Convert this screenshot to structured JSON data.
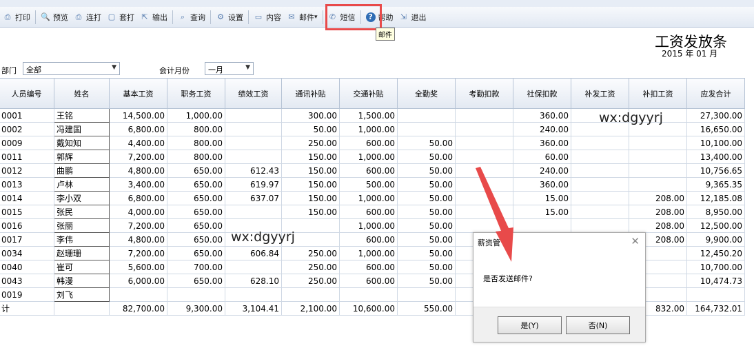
{
  "toolbar": {
    "items": [
      {
        "label": "打印",
        "icon": "printer-icon"
      },
      {
        "label": "预览",
        "icon": "preview-icon"
      },
      {
        "label": "连打",
        "icon": "batch-print-icon"
      },
      {
        "label": "套打",
        "icon": "template-print-icon"
      },
      {
        "label": "输出",
        "icon": "export-icon"
      },
      {
        "label": "查询",
        "icon": "search-icon"
      },
      {
        "label": "设置",
        "icon": "gear-icon"
      },
      {
        "label": "内容",
        "icon": "content-icon"
      },
      {
        "label": "邮件",
        "icon": "mail-icon"
      },
      {
        "label": "短信",
        "icon": "sms-icon"
      },
      {
        "label": "帮助",
        "icon": "help-icon"
      },
      {
        "label": "退出",
        "icon": "exit-icon"
      }
    ],
    "tooltip": "邮件"
  },
  "page": {
    "title": "工资发放条",
    "subtitle": "2015 年 01 月"
  },
  "filters": {
    "dept_label": "部门",
    "dept_value": "全部",
    "month_label": "会计月份",
    "month_value": "一月"
  },
  "table": {
    "headers": [
      "人员编号",
      "姓名",
      "基本工资",
      "职务工资",
      "绩效工资",
      "通讯补贴",
      "交通补贴",
      "全勤奖",
      "考勤扣款",
      "社保扣款",
      "补发工资",
      "补扣工资",
      "应发合计"
    ],
    "rows": [
      [
        "0001",
        "王铭",
        "14,500.00",
        "1,000.00",
        "",
        "300.00",
        "1,500.00",
        "",
        "",
        "360.00",
        "",
        "",
        "27,300.00"
      ],
      [
        "0002",
        "冯建国",
        "6,800.00",
        "800.00",
        "",
        "50.00",
        "1,000.00",
        "",
        "",
        "240.00",
        "",
        "",
        "16,650.00"
      ],
      [
        "0009",
        "戴知知",
        "4,400.00",
        "800.00",
        "",
        "250.00",
        "600.00",
        "50.00",
        "",
        "360.00",
        "",
        "",
        "10,100.00"
      ],
      [
        "0011",
        "郭辉",
        "7,200.00",
        "800.00",
        "",
        "150.00",
        "1,000.00",
        "50.00",
        "",
        "60.00",
        "",
        "",
        "13,400.00"
      ],
      [
        "0012",
        "曲鹏",
        "4,800.00",
        "650.00",
        "612.43",
        "150.00",
        "600.00",
        "50.00",
        "",
        "240.00",
        "",
        "",
        "10,756.65"
      ],
      [
        "0013",
        "卢林",
        "3,400.00",
        "650.00",
        "619.97",
        "150.00",
        "500.00",
        "50.00",
        "",
        "360.00",
        "",
        "",
        "9,365.35"
      ],
      [
        "0014",
        "李小双",
        "6,800.00",
        "650.00",
        "637.07",
        "150.00",
        "1,000.00",
        "50.00",
        "",
        "15.00",
        "",
        "208.00",
        "12,185.08"
      ],
      [
        "0015",
        "张民",
        "4,000.00",
        "650.00",
        "",
        "150.00",
        "600.00",
        "50.00",
        "",
        "15.00",
        "",
        "208.00",
        "8,950.00"
      ],
      [
        "0016",
        "张丽",
        "7,200.00",
        "650.00",
        "",
        "",
        "1,000.00",
        "50.00",
        "",
        "",
        "",
        "208.00",
        "12,500.00"
      ],
      [
        "0017",
        "李伟",
        "4,800.00",
        "650.00",
        "",
        "",
        "600.00",
        "50.00",
        "",
        "",
        "",
        "208.00",
        "9,900.00"
      ],
      [
        "0034",
        "赵珊珊",
        "7,200.00",
        "650.00",
        "606.84",
        "250.00",
        "1,000.00",
        "50.00",
        "",
        "",
        "",
        "",
        "12,450.20"
      ],
      [
        "0040",
        "崔可",
        "5,600.00",
        "700.00",
        "",
        "250.00",
        "600.00",
        "50.00",
        "",
        "",
        "",
        "",
        "10,700.00"
      ],
      [
        "0043",
        "韩漫",
        "6,000.00",
        "650.00",
        "628.10",
        "250.00",
        "600.00",
        "50.00",
        "",
        "",
        "",
        "",
        "10,474.73"
      ],
      [
        "0019",
        "刘飞",
        "",
        "",
        "",
        "",
        "",
        "",
        "",
        "",
        "",
        "",
        ""
      ]
    ],
    "total": [
      "计",
      "",
      "82,700.00",
      "9,300.00",
      "3,104.41",
      "2,100.00",
      "10,600.00",
      "550.00",
      "",
      "",
      "",
      "832.00",
      "164,732.01"
    ]
  },
  "watermarks": [
    "wx:dgyyrj",
    "wx:dgyyrj"
  ],
  "dialog": {
    "title": "薪资管",
    "message": "是否发送邮件?",
    "yes_label": "是(Y)",
    "no_label": "否(N)"
  },
  "colors": {
    "highlight": "#e84a4a",
    "arrow": "#e84a4a",
    "header_bg": "#e3e9f2"
  }
}
